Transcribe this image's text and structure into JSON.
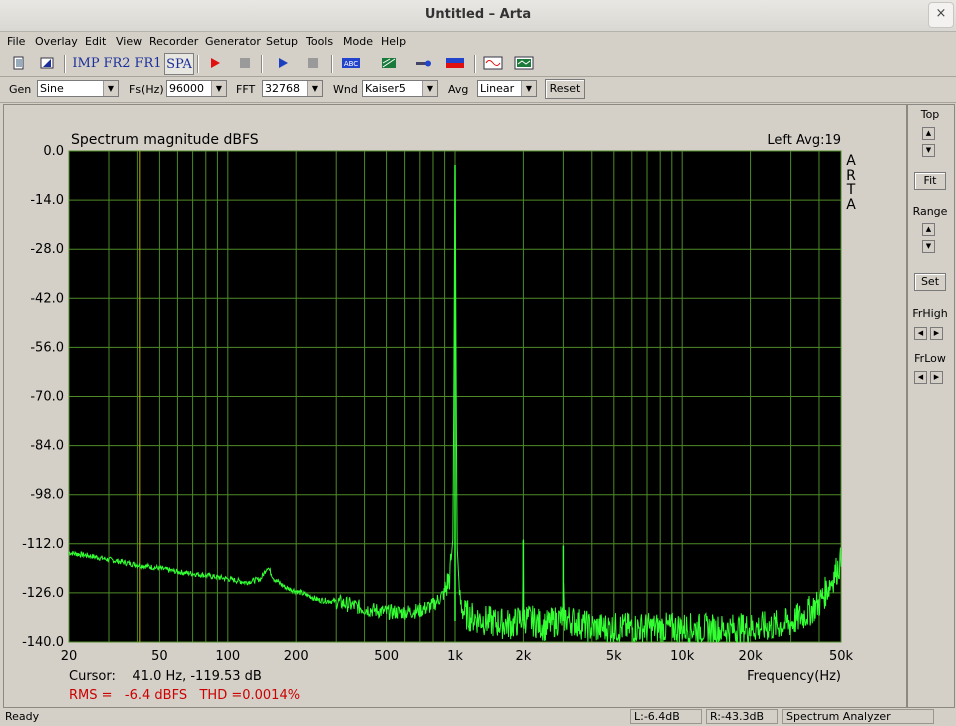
{
  "window": {
    "title": "Untitled – Arta",
    "close_glyph": "×"
  },
  "menu": [
    "File",
    "Overlay",
    "Edit",
    "View",
    "Recorder",
    "Generator",
    "Setup",
    "Tools",
    "Mode",
    "Help"
  ],
  "toolbar": {
    "imp": "IMP",
    "fr2": "FR2",
    "fr1": "FR1",
    "spa": "SPA",
    "icons": [
      "new-document-icon",
      "load-icon",
      "imp-mode-icon",
      "fr2-mode-icon",
      "fr1-mode-icon",
      "spa-mode-icon",
      "record-icon",
      "stop-icon",
      "play-icon",
      "stop-play-icon",
      "abc-overlay-icon",
      "waterfall-icon",
      "calibrate-icon",
      "level-meter-icon",
      "generator-wave-icon",
      "scope-icon"
    ]
  },
  "controls": {
    "gen_label": "Gen",
    "gen_value": "Sine",
    "fs_label": "Fs(Hz)",
    "fs_value": "96000",
    "fft_label": "FFT",
    "fft_value": "32768",
    "wnd_label": "Wnd",
    "wnd_value": "Kaiser5",
    "avg_label": "Avg",
    "avg_value": "Linear",
    "reset_label": "Reset"
  },
  "side": {
    "top_label": "Top",
    "fit_label": "Fit",
    "range_label": "Range",
    "set_label": "Set",
    "frhigh_label": "FrHigh",
    "frlow_label": "FrLow"
  },
  "chart_data": {
    "type": "line",
    "title": "Spectrum magnitude dBFS",
    "channel_info": "Left  Avg:19",
    "watermark": [
      "A",
      "R",
      "T",
      "A"
    ],
    "xlabel": "Frequency(Hz)",
    "x_scale": "log",
    "xlim": [
      20,
      50000
    ],
    "ylim": [
      -140,
      0
    ],
    "grid": true,
    "y_ticks": [
      "0.0",
      "-14.0",
      "-28.0",
      "-42.0",
      "-56.0",
      "-70.0",
      "-84.0",
      "-98.0",
      "-112.0",
      "-126.0",
      "-140.0"
    ],
    "x_ticks": [
      {
        "value": 20,
        "label": "20"
      },
      {
        "value": 50,
        "label": "50"
      },
      {
        "value": 100,
        "label": "100"
      },
      {
        "value": 200,
        "label": "200"
      },
      {
        "value": 500,
        "label": "500"
      },
      {
        "value": 1000,
        "label": "1k"
      },
      {
        "value": 2000,
        "label": "2k"
      },
      {
        "value": 5000,
        "label": "5k"
      },
      {
        "value": 10000,
        "label": "10k"
      },
      {
        "value": 20000,
        "label": "20k"
      },
      {
        "value": 50000,
        "label": "50k"
      }
    ],
    "cursor_hz": 41.0,
    "cursor_text": "Cursor:    41.0 Hz, -119.53 dB",
    "rms_text": "RMS =   -6.4 dBFS   THD =0.0014%",
    "colors": {
      "background": "#000000",
      "grid": "#4e8b26",
      "trace": "#33ff33",
      "cursor": "#c8b400",
      "axis_text": "#000000",
      "rms_text": "#cc0000"
    },
    "series": [
      {
        "x": [
          20,
          25,
          30,
          40,
          50,
          60,
          70,
          80,
          100,
          120,
          140,
          150,
          160,
          180,
          200,
          230,
          250,
          300,
          350,
          400,
          450,
          500,
          600,
          700,
          800,
          900,
          950,
          980,
          1000,
          1020,
          1050,
          1100,
          1200,
          1500,
          1800,
          1990,
          2000,
          2010,
          2500,
          2990,
          3000,
          3010,
          4000,
          5000,
          7000,
          10000,
          15000,
          20000,
          25000,
          30000,
          35000,
          40000,
          45000,
          50000
        ],
        "y": [
          -114.5,
          -115.5,
          -116.5,
          -118,
          -119,
          -120,
          -120.5,
          -121,
          -122,
          -123,
          -122,
          -118.5,
          -122,
          -124.5,
          -125.5,
          -127,
          -128,
          -128.5,
          -129.5,
          -130.5,
          -131,
          -131.5,
          -131.5,
          -131,
          -129.5,
          -126,
          -121,
          -110,
          -4,
          -112,
          -128,
          -132,
          -133,
          -134.5,
          -135,
          -133,
          -111,
          -133,
          -135.5,
          -133,
          -112.5,
          -133,
          -136,
          -136,
          -136,
          -136,
          -136.5,
          -136,
          -135.5,
          -134.5,
          -132,
          -129,
          -123,
          -117
        ]
      }
    ],
    "spikes": [
      {
        "x": 1000,
        "y": -4
      },
      {
        "x": 2000,
        "y": -111
      },
      {
        "x": 3000,
        "y": -112.5
      }
    ]
  },
  "status": {
    "ready": "Ready",
    "left_level": "L:-6.4dB",
    "right_level": "R:-43.3dB",
    "mode": "Spectrum Analyzer"
  }
}
